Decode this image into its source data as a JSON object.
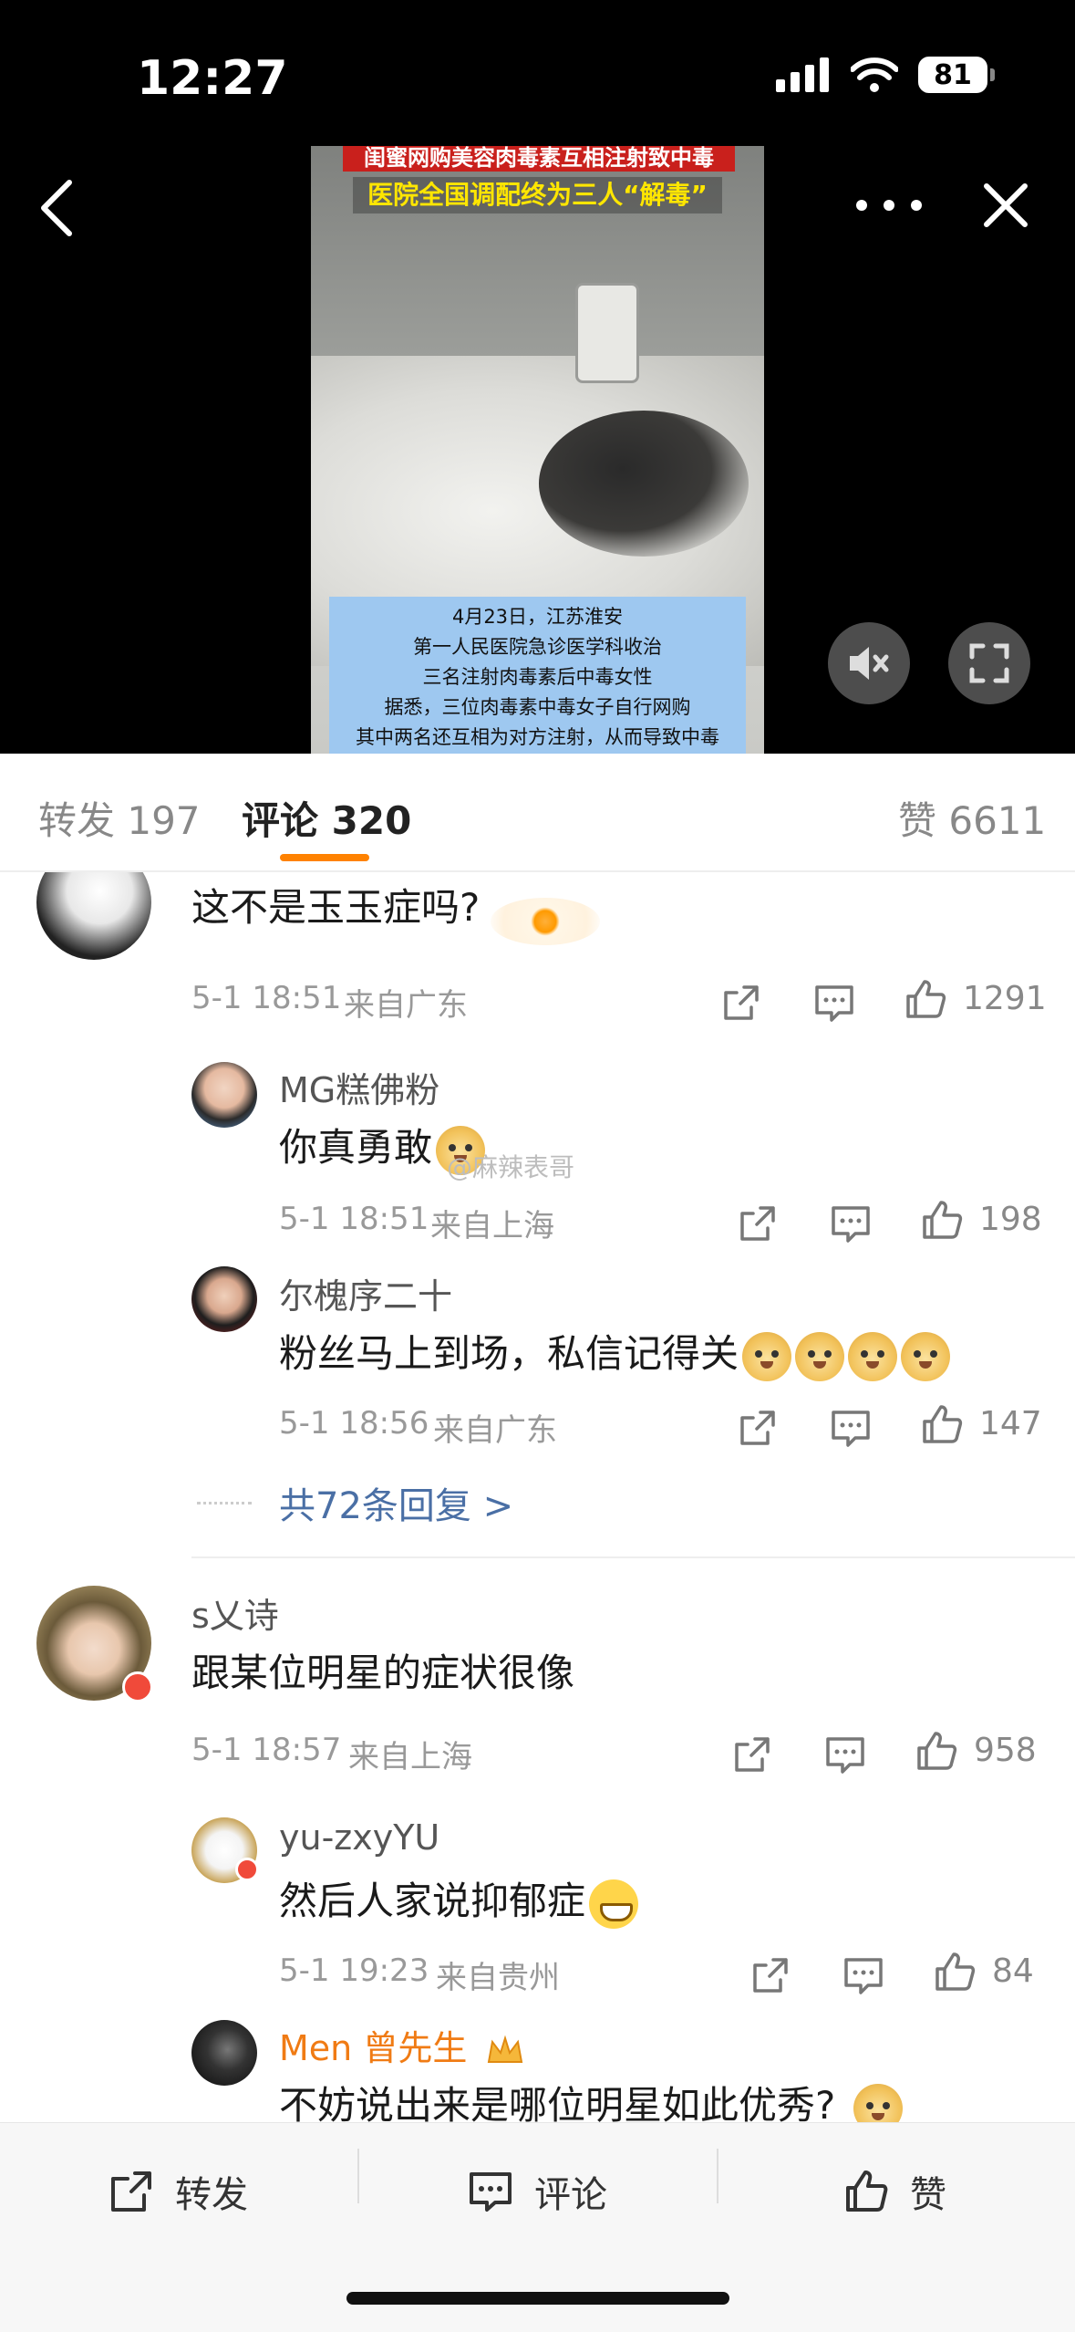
{
  "status": {
    "time": "12:27",
    "battery": "81"
  },
  "video": {
    "caption_top": "闺蜜网购美容肉毒素互相注射致中毒",
    "caption_headline": "医院全国调配终为三人“解毒”",
    "caption_lines": [
      "4月23日，江苏淮安",
      "第一人民医院急诊医学科收治",
      "三名注射肉毒素后中毒女性",
      "据悉，三位肉毒素中毒女子自行网购",
      "其中两名还互相为对方注射，从而导致中毒"
    ]
  },
  "tabs": {
    "repost": "转发 197",
    "comments": "评论 320",
    "likes": "赞 6611"
  },
  "comments": [
    {
      "text": "这不是玉玉症吗?",
      "time": "5-1 18:51",
      "location": "来自广东",
      "likes": "1291",
      "replies": [
        {
          "user": "MG糕佛粉",
          "text": "你真勇敢",
          "time": "5-1 18:51",
          "location": "来自上海",
          "likes": "198"
        },
        {
          "user": "尔槐序二十",
          "text": "粉丝马上到场，私信记得关",
          "time": "5-1 18:56",
          "location": "来自广东",
          "likes": "147"
        }
      ],
      "more_replies": "共72条回复 >"
    },
    {
      "user": "s乂诗",
      "text": "跟某位明星的症状很像",
      "time": "5-1 18:57",
      "location": "来自上海",
      "likes": "958",
      "replies": [
        {
          "user": "yu-zxyYU",
          "text": "然后人家说抑郁症",
          "time": "5-1 19:23",
          "location": "来自贵州",
          "likes": "84"
        },
        {
          "user": "Men 曾先生",
          "text": "不妨说出来是哪位明星如此优秀?"
        }
      ]
    }
  ],
  "watermark": "@麻辣表哥",
  "colors": {
    "accent": "#ff8200",
    "link": "#4a6fa5",
    "vip_name": "#f07b14"
  },
  "bottom_bar": {
    "repost": "转发",
    "comment": "评论",
    "like": "赞"
  }
}
